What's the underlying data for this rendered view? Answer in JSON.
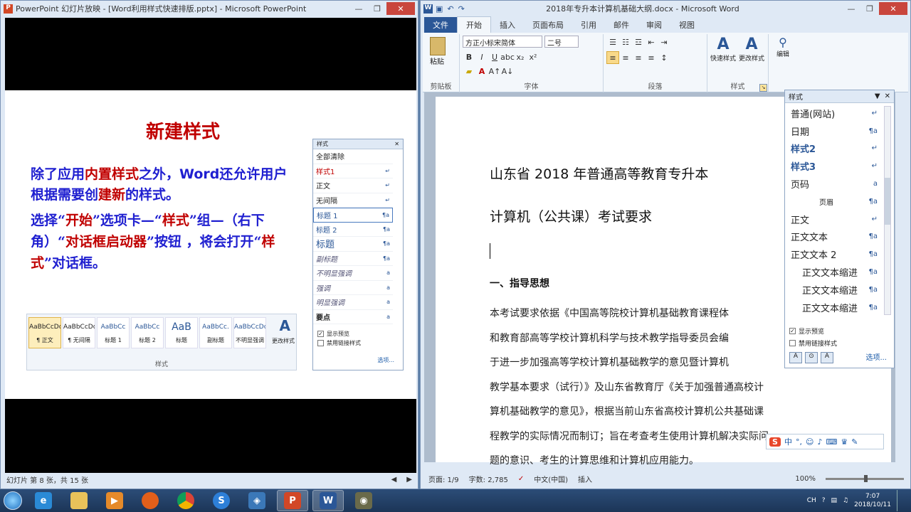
{
  "ppt": {
    "title": "PowerPoint 幻灯片放映 - [Word利用样式快速排版.pptx] - Microsoft PowerPoint",
    "slide_title": "新建样式",
    "p1_parts": [
      "除了应用",
      "内置样式",
      "之外，",
      "Word",
      "还允许用户根据需要创",
      "建新",
      "的样式。"
    ],
    "p2_parts": [
      "选择“",
      "开始",
      "”选项卡—“",
      "样式",
      "”组—（右下角）“",
      "对话框启动器",
      "”按钮 ，将会打开“",
      "样式",
      "”对话框。"
    ],
    "gallery": [
      {
        "sample": "AaBbCcDc",
        "name": "¶ 正文"
      },
      {
        "sample": "AaBbCcDc",
        "name": "¶ 无间隔"
      },
      {
        "sample": "AaBbCc",
        "name": "标题 1"
      },
      {
        "sample": "AaBbCc",
        "name": "标题 2"
      },
      {
        "sample": "AaB",
        "name": "标题"
      },
      {
        "sample": "AaBbCc.",
        "name": "副标题"
      },
      {
        "sample": "AaBbCcDc",
        "name": "不明显强调"
      }
    ],
    "gallery_change": "更改样式",
    "gallery_group": "样式",
    "mini_pane": {
      "title": "样式",
      "items": [
        {
          "name": "全部清除",
          "mark": ""
        },
        {
          "name": "样式1",
          "mark": "↵"
        },
        {
          "name": "正文",
          "mark": "↵"
        },
        {
          "name": "无间隔",
          "mark": "↵"
        },
        {
          "name": "标题 1",
          "mark": "¶a"
        },
        {
          "name": "标题 2",
          "mark": "¶a"
        },
        {
          "name": "标题",
          "mark": "¶a"
        },
        {
          "name": "副标题",
          "mark": "¶a"
        },
        {
          "name": "不明显强调",
          "mark": "a"
        },
        {
          "name": "强调",
          "mark": "a"
        },
        {
          "name": "明显强调",
          "mark": "a"
        },
        {
          "name": "要点",
          "mark": "a"
        }
      ],
      "show_preview": "显示预览",
      "disable_linked": "禁用链接样式",
      "options": "选项..."
    },
    "status": "幻灯片 第 8 张，共 15 张"
  },
  "word": {
    "title": "2018年专升本计算机基础大纲.docx - Microsoft Word",
    "tabs": [
      "文件",
      "开始",
      "插入",
      "页面布局",
      "引用",
      "邮件",
      "审阅",
      "视图"
    ],
    "font_name": "方正小标宋简体",
    "font_size": "二号",
    "groups": {
      "clipboard": "剪贴板",
      "font": "字体",
      "paragraph": "段落",
      "styles": "样式",
      "editing": "编辑"
    },
    "paste": "粘贴",
    "quick_styles": "快速样式",
    "change_styles": "更改样式",
    "edit": "编辑",
    "doc": {
      "title1": "山东省 2018 年普通高等教育专升本",
      "title2": "计算机（公共课）考试要求",
      "heading": "一、指导思想",
      "body": [
        "本考试要求依据《中国高等院校计算机基础教育课程体",
        "和教育部高等学校计算机科学与技术教学指导委员会编",
        "于进一步加强高等学校计算机基础教学的意见暨计算机",
        "教学基本要求（试行）》及山东省教育厅《关于加强普通高校计",
        "算机基础教学的意见》，根据当前山东省高校计算机公共基础课",
        "程教学的实际情况而制订；旨在考查考生使用计算机解决实际问",
        "题的意识、考生的计算思维和计算机应用能力。"
      ]
    },
    "styles_pane": {
      "title": "样式",
      "items": [
        {
          "name": "普通(网站)",
          "mark": "↵"
        },
        {
          "name": "日期",
          "mark": "¶a"
        },
        {
          "name": "样式2",
          "mark": "↵"
        },
        {
          "name": "样式3",
          "mark": "↵"
        },
        {
          "name": "页码",
          "mark": "a"
        },
        {
          "name": "页眉",
          "mark": "¶a"
        },
        {
          "name": "正文",
          "mark": "↵"
        },
        {
          "name": "正文文本",
          "mark": "¶a"
        },
        {
          "name": "正文文本 2",
          "mark": "¶a"
        },
        {
          "name": "正文文本缩进",
          "mark": "¶a"
        },
        {
          "name": "正文文本缩进",
          "mark": "¶a"
        },
        {
          "name": "正文文本缩进",
          "mark": "¶a"
        }
      ],
      "show_preview": "显示预览",
      "disable_linked": "禁用链接样式",
      "options": "选项..."
    },
    "status": {
      "page": "页面: 1/9",
      "words": "字数: 2,785",
      "lang": "中文(中国)",
      "mode": "插入",
      "zoom": "100%"
    }
  },
  "ime": "中",
  "tray": {
    "lang": "CH",
    "time": "7:07",
    "date": "2018/10/11"
  }
}
